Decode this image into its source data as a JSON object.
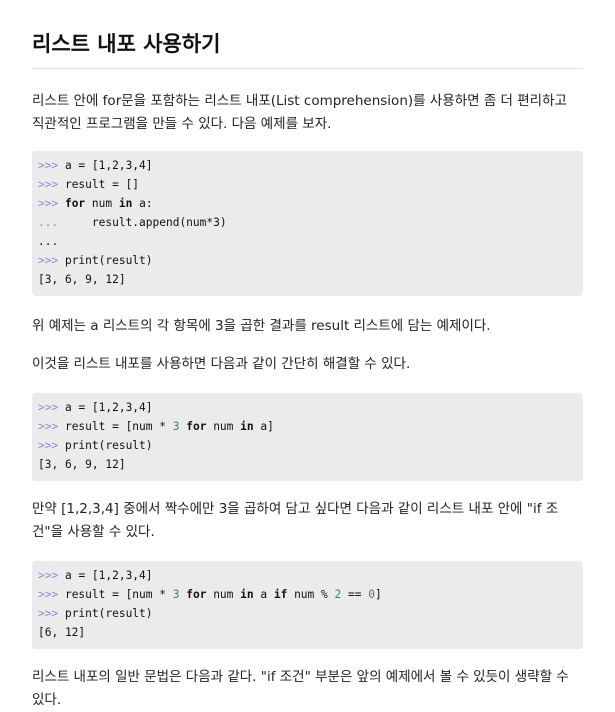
{
  "title": "리스트 내포 사용하기",
  "paragraphs": [
    "리스트 안에 for문을 포함하는 리스트 내포(List comprehension)를 사용하면 좀 더 편리하고 직관적인 프로그램을 만들 수 있다. 다음 예제를 보자.",
    "위 예제는 a 리스트의 각 항목에 3을 곱한 결과를 result 리스트에 담는 예제이다.",
    "이것을 리스트 내포를 사용하면 다음과 같이 간단히 해결할 수 있다.",
    "만약 [1,2,3,4] 중에서 짝수에만 3을 곱하여 담고 싶다면 다음과 같이 리스트 내포 안에 \"if 조건\"을 사용할 수 있다.",
    "리스트 내포의 일반 문법은 다음과 같다. \"if 조건\" 부분은 앞의 예제에서 볼 수 있듯이 생략할 수 있다."
  ],
  "code_blocks": [
    {
      "lines": [
        [
          {
            "t": "pr",
            "v": ">>> "
          },
          {
            "t": "plain",
            "v": "a = [1,2,3,4]"
          }
        ],
        [
          {
            "t": "pr",
            "v": ">>> "
          },
          {
            "t": "plain",
            "v": "result = []"
          }
        ],
        [
          {
            "t": "pr",
            "v": ">>> "
          },
          {
            "t": "kw",
            "v": "for"
          },
          {
            "t": "plain",
            "v": " num "
          },
          {
            "t": "kw",
            "v": "in"
          },
          {
            "t": "plain",
            "v": " a:"
          }
        ],
        [
          {
            "t": "pr",
            "v": "...     "
          },
          {
            "t": "plain",
            "v": "result.append(num*3)"
          }
        ],
        [
          {
            "t": "plain",
            "v": "..."
          }
        ],
        [
          {
            "t": "pr",
            "v": ">>> "
          },
          {
            "t": "plain",
            "v": "print(result)"
          }
        ],
        [
          {
            "t": "plain",
            "v": "[3, 6, 9, 12]"
          }
        ]
      ]
    },
    {
      "lines": [
        [
          {
            "t": "pr",
            "v": ">>> "
          },
          {
            "t": "plain",
            "v": "a = [1,2,3,4]"
          }
        ],
        [
          {
            "t": "pr",
            "v": ">>> "
          },
          {
            "t": "plain",
            "v": "result = [num * "
          },
          {
            "t": "num",
            "v": "3"
          },
          {
            "t": "plain",
            "v": " "
          },
          {
            "t": "kw",
            "v": "for"
          },
          {
            "t": "plain",
            "v": " num "
          },
          {
            "t": "kw",
            "v": "in"
          },
          {
            "t": "plain",
            "v": " a]"
          }
        ],
        [
          {
            "t": "pr",
            "v": ">>> "
          },
          {
            "t": "plain",
            "v": "print(result)"
          }
        ],
        [
          {
            "t": "plain",
            "v": "[3, 6, 9, 12]"
          }
        ]
      ]
    },
    {
      "lines": [
        [
          {
            "t": "pr",
            "v": ">>> "
          },
          {
            "t": "plain",
            "v": "a = [1,2,3,4]"
          }
        ],
        [
          {
            "t": "pr",
            "v": ">>> "
          },
          {
            "t": "plain",
            "v": "result = [num * "
          },
          {
            "t": "num",
            "v": "3"
          },
          {
            "t": "plain",
            "v": " "
          },
          {
            "t": "kw",
            "v": "for"
          },
          {
            "t": "plain",
            "v": " num "
          },
          {
            "t": "kw",
            "v": "in"
          },
          {
            "t": "plain",
            "v": " a "
          },
          {
            "t": "kw",
            "v": "if"
          },
          {
            "t": "plain",
            "v": " num % "
          },
          {
            "t": "num",
            "v": "2"
          },
          {
            "t": "plain",
            "v": " == "
          },
          {
            "t": "num",
            "v": "0"
          },
          {
            "t": "plain",
            "v": "]"
          }
        ],
        [
          {
            "t": "pr",
            "v": ">>> "
          },
          {
            "t": "plain",
            "v": "print(result)"
          }
        ],
        [
          {
            "t": "plain",
            "v": "[6, 12]"
          }
        ]
      ]
    }
  ],
  "colors": {
    "prompt": "#8a8ad9",
    "number": "#2e8b57",
    "code_background": "#ebebeb"
  }
}
